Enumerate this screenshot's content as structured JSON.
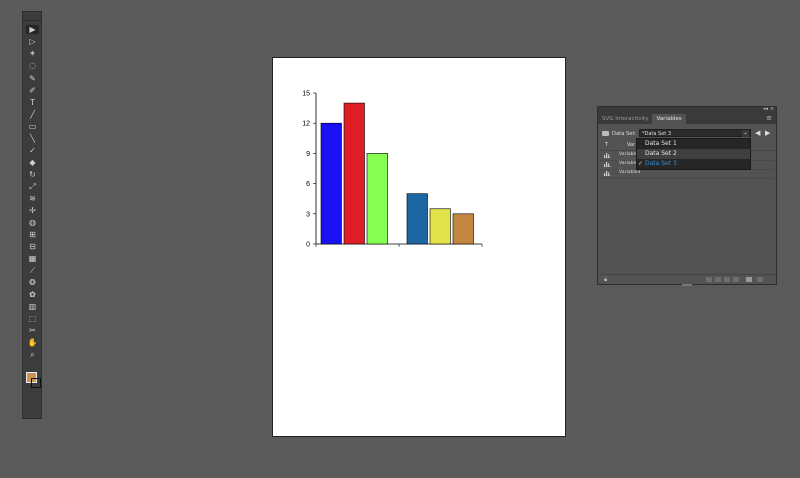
{
  "toolbar": {
    "tools": [
      "selection-tool",
      "direct-selection-tool",
      "magic-wand-tool",
      "lasso-tool",
      "pen-tool",
      "curvature-tool",
      "type-tool",
      "line-segment-tool",
      "rectangle-tool",
      "paintbrush-tool",
      "shaper-tool",
      "eraser-tool",
      "rotate-tool",
      "scale-tool",
      "width-tool",
      "puppet-warp-tool",
      "shape-builder-tool",
      "perspective-grid-tool",
      "mesh-tool",
      "gradient-tool",
      "eyedropper-tool",
      "blend-tool",
      "symbol-sprayer-tool",
      "column-graph-tool",
      "artboard-tool",
      "slice-tool",
      "hand-tool",
      "zoom-tool"
    ]
  },
  "colors": {
    "fill": "#c8964f",
    "stroke": "#111111"
  },
  "chart_data": {
    "type": "bar",
    "y_ticks": [
      "15",
      "12",
      "9",
      "6",
      "3",
      "0"
    ],
    "ylim": [
      0,
      15
    ],
    "groups": [
      {
        "bars": [
          {
            "value": 12,
            "color": "#1a10f5"
          },
          {
            "value": 14,
            "color": "#e01e26"
          },
          {
            "value": 9,
            "color": "#86ff52"
          }
        ]
      },
      {
        "bars": [
          {
            "value": 5,
            "color": "#1c66a3"
          },
          {
            "value": 3.5,
            "color": "#e2e24a"
          },
          {
            "value": 3,
            "color": "#c4863f"
          }
        ]
      }
    ],
    "title": "",
    "xlabel": "",
    "ylabel": ""
  },
  "panel": {
    "tabs": [
      {
        "label": "SVG Interactivity",
        "active": false
      },
      {
        "label": "Variables",
        "active": true
      }
    ],
    "data_set_label": "Data Set:",
    "data_set_value": "*Data Set 3",
    "columns": {
      "type": "T",
      "name": "Var"
    },
    "variables": [
      {
        "name": "Variable"
      },
      {
        "name": "Variable"
      },
      {
        "name": "Variable3"
      }
    ],
    "dropdown_options": [
      {
        "label": "Data Set 1",
        "highlighted": false,
        "current": false
      },
      {
        "label": "Data Set 2",
        "highlighted": true,
        "current": false
      },
      {
        "label": "Data Set 3",
        "highlighted": false,
        "current": true
      }
    ]
  }
}
